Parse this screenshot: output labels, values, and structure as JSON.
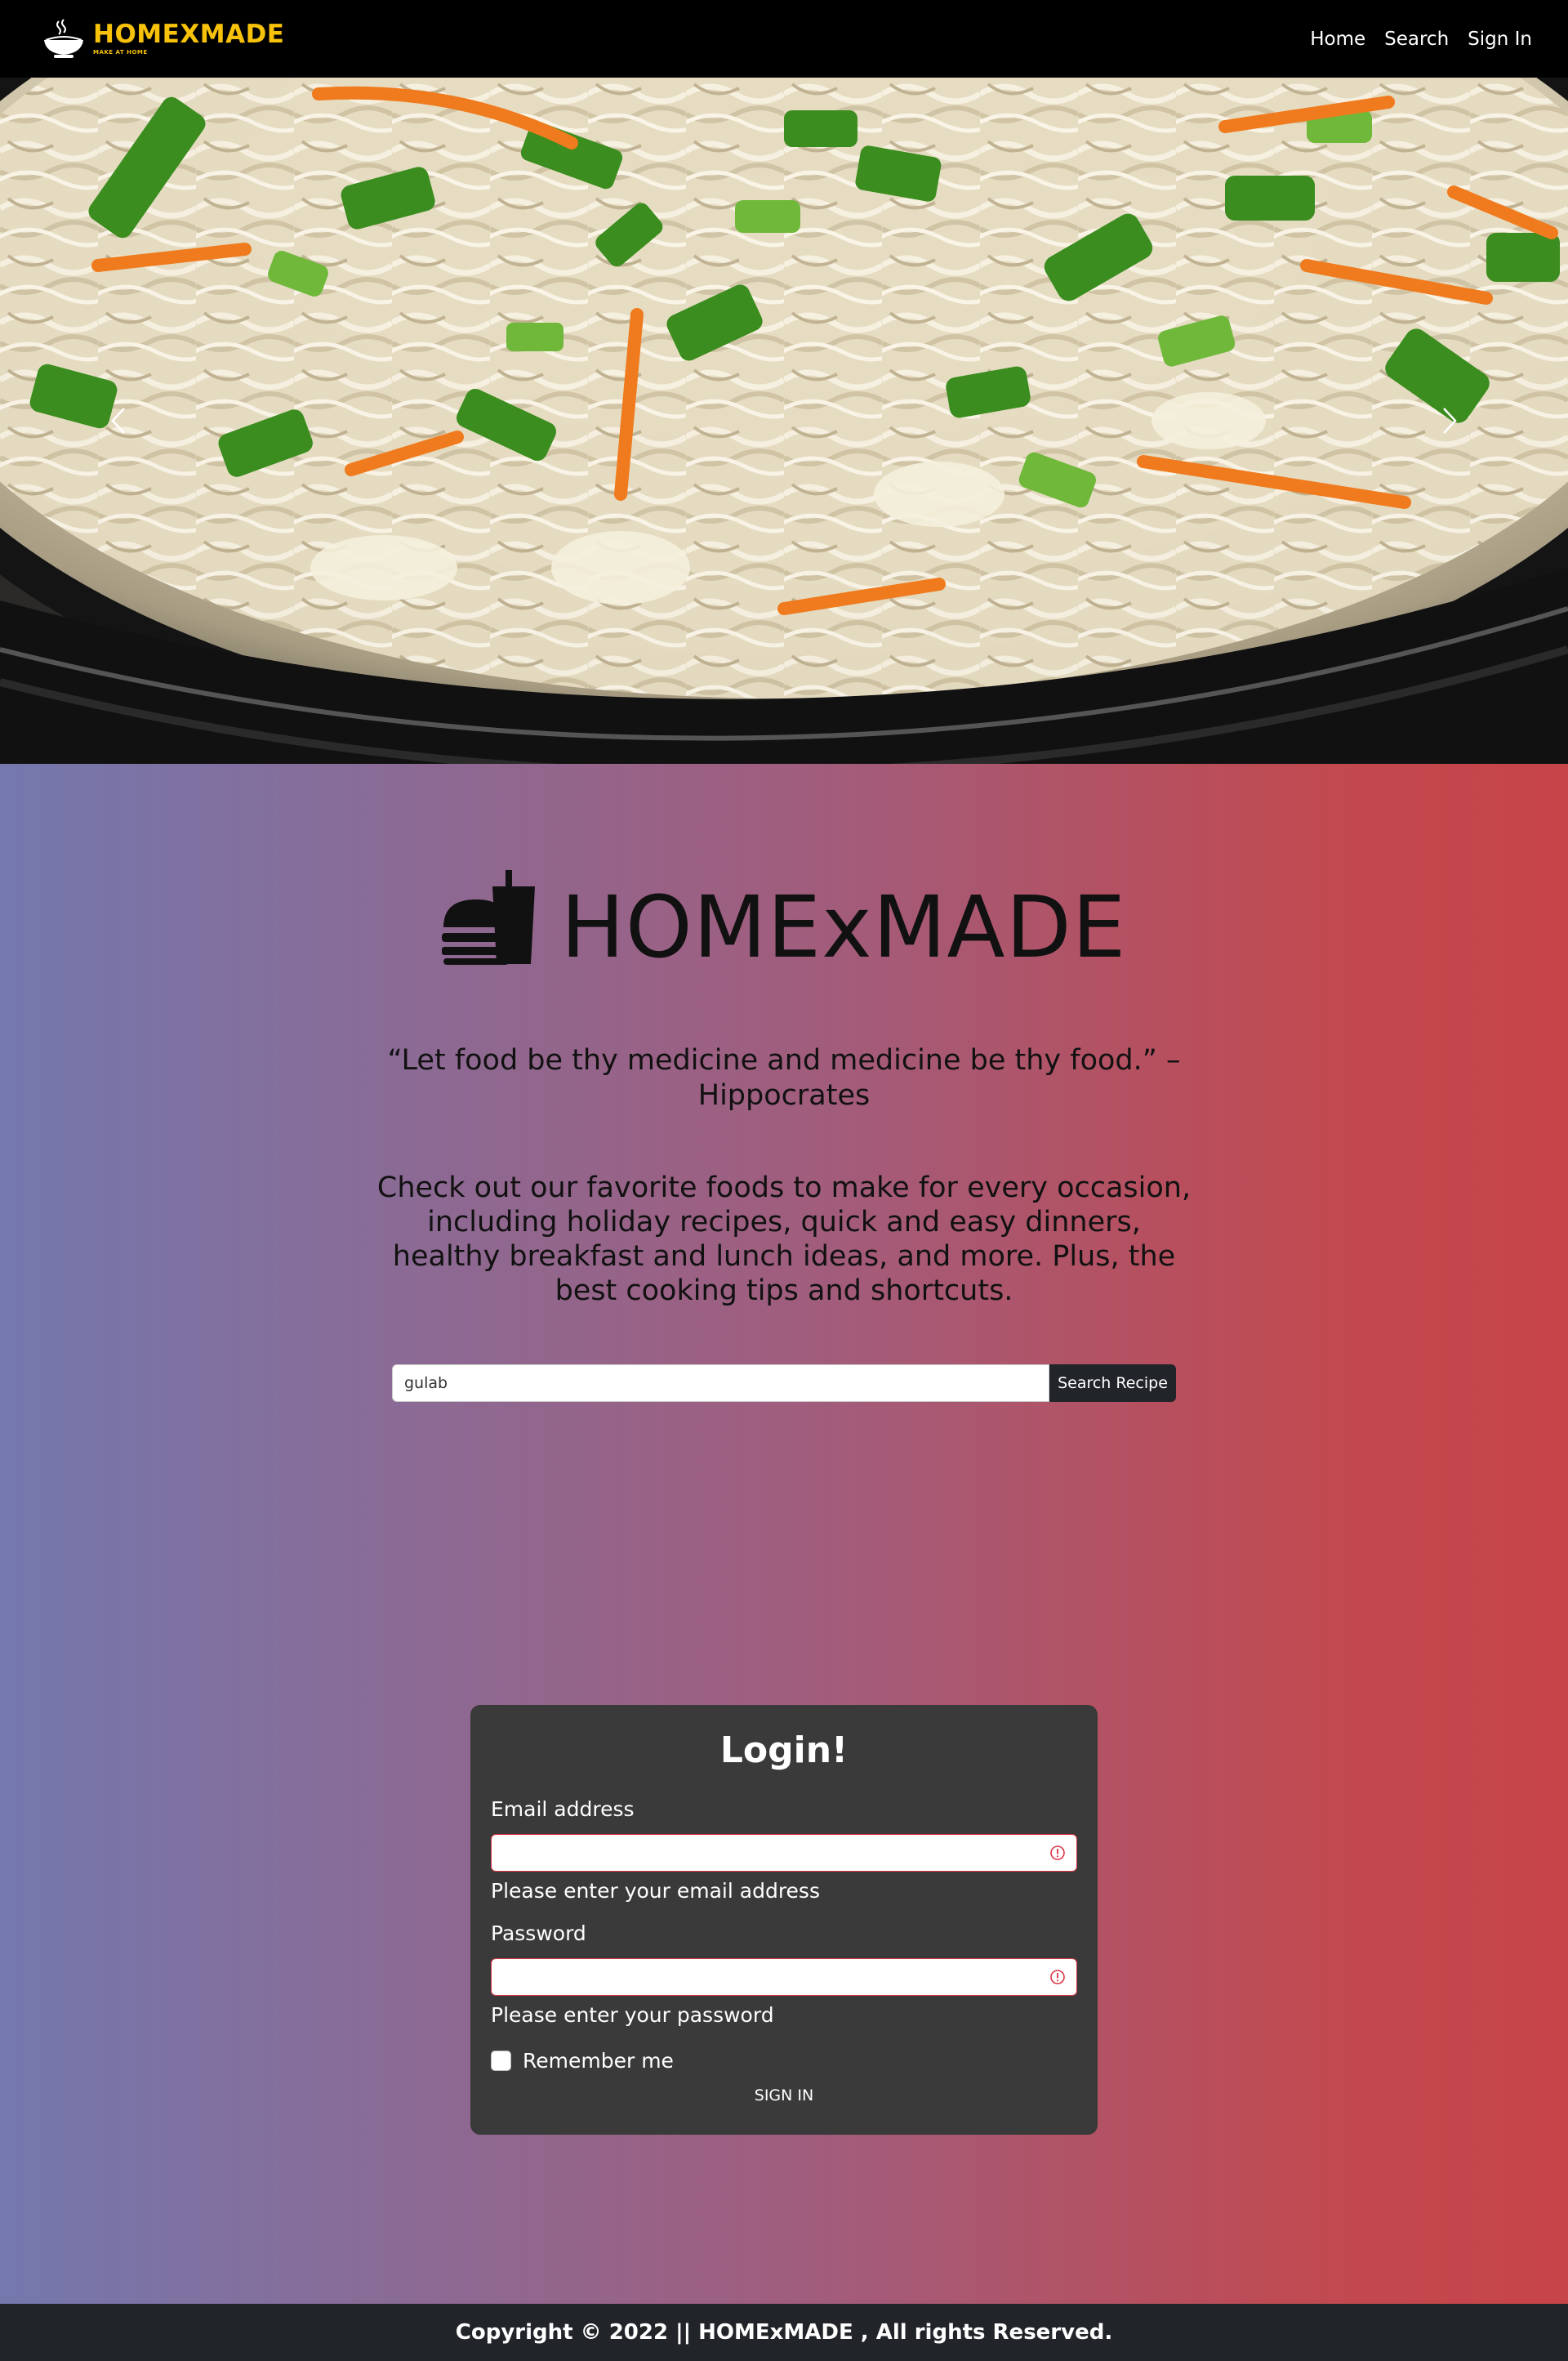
{
  "navbar": {
    "brand_name": "HOMEXMADE",
    "brand_tagline": "MAKE AT HOME",
    "links": [
      {
        "label": "Home"
      },
      {
        "label": "Search"
      },
      {
        "label": "Sign In"
      }
    ]
  },
  "hero": {
    "image_subject": "vegetable-hakka-noodles",
    "prev_icon": "chevron-left-icon",
    "next_icon": "chevron-right-icon"
  },
  "main": {
    "brand_title": "HOMExMADE",
    "quote": "“Let food be thy medicine and medicine be thy food.” – Hippocrates",
    "description": "Check out our favorite foods to make for every occasion, including holiday recipes, quick and easy dinners, healthy breakfast and lunch ideas, and more. Plus, the best cooking tips and shortcuts.",
    "search": {
      "value": "gulab",
      "button_label": "Search Recipe"
    }
  },
  "login": {
    "title": "Login!",
    "email_label": "Email address",
    "email_value": "",
    "email_error": "Please enter your email address",
    "password_label": "Password",
    "password_value": "",
    "password_error": "Please enter your password",
    "remember_label": "Remember me",
    "remember_checked": false,
    "submit_label": "SIGN IN"
  },
  "footer": {
    "copyright": "Copyright © 2022 || HOMExMADE , All rights Reserved."
  },
  "colors": {
    "brand_yellow": "#f8c20a",
    "navbar_bg": "#000000",
    "gradient_left": "#7478ad",
    "gradient_right": "#c74449",
    "card_bg": "#3a3a3a",
    "error_red": "#dc3545",
    "footer_bg": "#212529"
  }
}
